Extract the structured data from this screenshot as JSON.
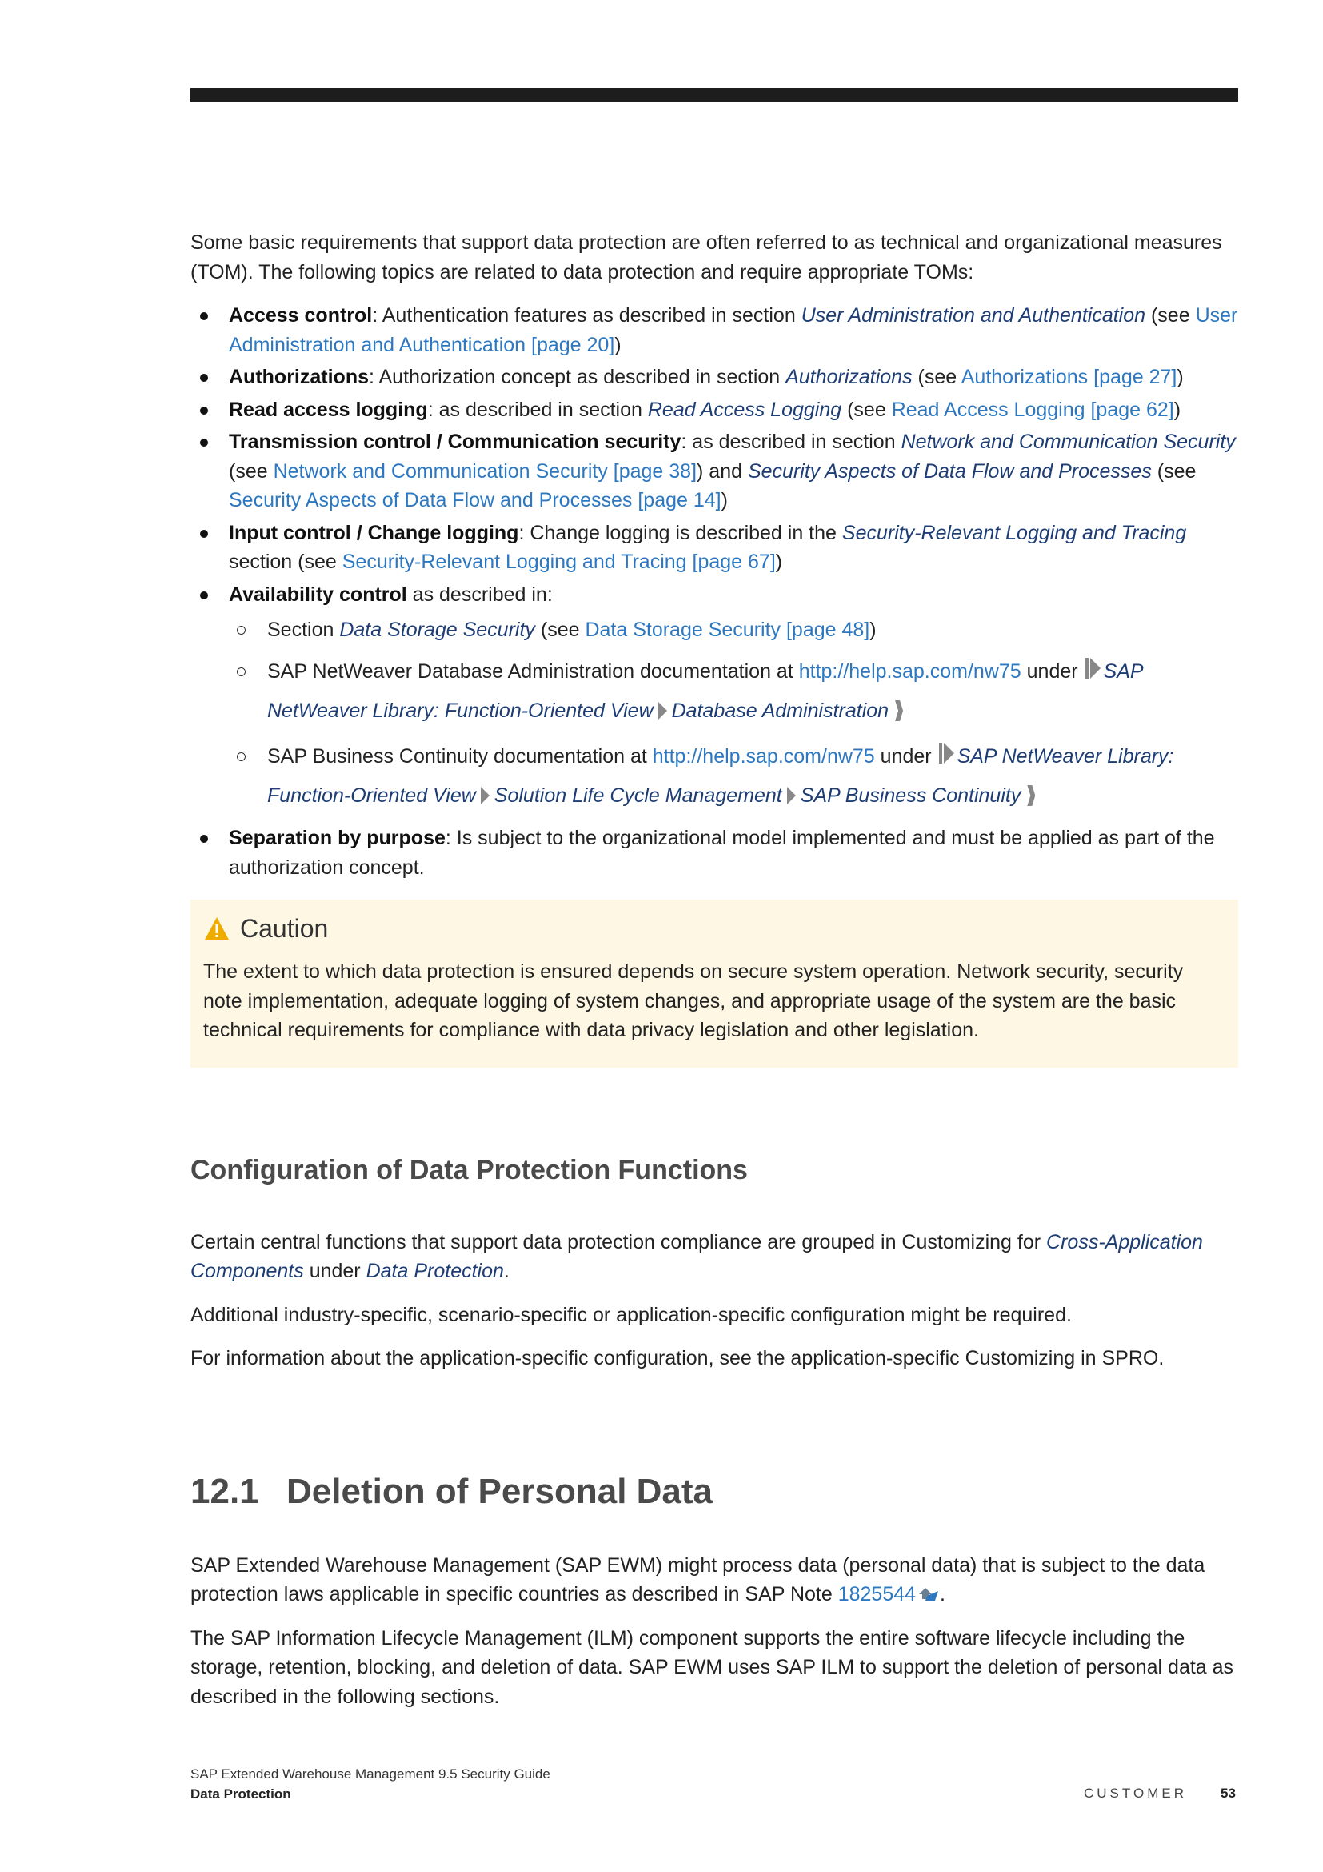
{
  "intro": "Some basic requirements that support data protection are often referred to as technical and organizational measures (TOM). The following topics are related to data protection and require appropriate TOMs:",
  "list": [
    {
      "term": "Access control",
      "t1": ": Authentication features as described in section ",
      "sec": "User Administration and Authentication",
      "t2": " (see ",
      "link": "User Administration and Authentication [page 20]",
      "t3": ")"
    },
    {
      "term": "Authorizations",
      "t1": ": Authorization concept as described in section ",
      "sec": "Authorizations",
      "t2": " (see ",
      "link": "Authorizations [page 27]",
      "t3": ")"
    },
    {
      "term": "Read access logging",
      "t1": ": as described in section ",
      "sec": "Read Access Logging",
      "t2": " (see ",
      "link": "Read Access Logging [page 62]",
      "t3": ")"
    },
    {
      "term": "Transmission control / Communication security",
      "t1": ": as described in section ",
      "sec": "Network and Communication Security",
      "t2": " (see ",
      "link": "Network and Communication Security [page 38]",
      "t3": ") and ",
      "sec2": "Security Aspects of Data Flow and Processes",
      "t4": " (see ",
      "link2": "Security Aspects of Data Flow and Processes [page 14]",
      "t5": ")"
    },
    {
      "term": "Input control / Change logging",
      "t1": ": Change logging is described in the ",
      "sec": "Security-Relevant Logging and Tracing",
      "t2": " section (see ",
      "link": "Security-Relevant Logging and Tracing [page 67]",
      "t3": ")"
    },
    {
      "term": "Availability control",
      "t1": " as described in:"
    },
    {
      "term": "Separation by purpose",
      "t1": ": Is subject to the organizational model implemented and must be applied as part of the authorization concept."
    }
  ],
  "availability": [
    {
      "t1": "Section ",
      "sec": "Data Storage Security",
      "t2": " (see ",
      "link": "Data Storage Security [page 48]",
      "t3": ")"
    },
    {
      "t1": "SAP NetWeaver Database Administration documentation at ",
      "url": "http://help.sap.com/nw75",
      "t2": " under ",
      "path": [
        "SAP NetWeaver Library: Function-Oriented View",
        "Database Administration"
      ]
    },
    {
      "t1": "SAP Business Continuity documentation at ",
      "url": "http://help.sap.com/nw75",
      "t2": " under ",
      "path": [
        "SAP NetWeaver Library: Function-Oriented View",
        "Solution Life Cycle Management",
        "SAP Business Continuity"
      ]
    }
  ],
  "caution": {
    "title": "Caution",
    "text": "The extent to which data protection is ensured depends on secure system operation. Network security, security note implementation, adequate logging of system changes, and appropriate usage of the system are the basic technical requirements for compliance with data privacy legislation and other legislation.",
    "icon": "warning-icon",
    "icon_color": "#f0ab00",
    "bg_color": "#fef7e4"
  },
  "config": {
    "heading": "Configuration of Data Protection Functions",
    "p1_a": "Certain central functions that support data protection compliance are grouped in Customizing for ",
    "p1_sec": "Cross-Application Components",
    "p1_b": " under ",
    "p1_sec2": "Data Protection",
    "p1_c": ".",
    "p2": "Additional industry-specific, scenario-specific or application-specific configuration might be required.",
    "p3": "For information about the application-specific configuration, see the application-specific Customizing in SPRO."
  },
  "section": {
    "number": "12.1",
    "title": "Deletion of Personal Data",
    "p1_a": "SAP Extended Warehouse Management (SAP EWM) might process data (personal data) that is subject to the data protection laws applicable in specific countries as described in SAP Note ",
    "p1_link": "1825544",
    "p1_b": ".",
    "p2": "The SAP Information Lifecycle Management (ILM) component supports the entire software lifecycle including the storage, retention, blocking, and deletion of data. SAP EWM uses SAP ILM to support the deletion of personal data as described in the following sections."
  },
  "footer": {
    "doc_title": "SAP Extended Warehouse Management 9.5 Security Guide",
    "chapter": "Data Protection",
    "classification": "CUSTOMER",
    "page": "53"
  },
  "colors": {
    "link": "#2d78c0",
    "italic_ref": "#1d3d74",
    "heading": "#4a4a4a",
    "top_bar": "#1d1d1d"
  }
}
